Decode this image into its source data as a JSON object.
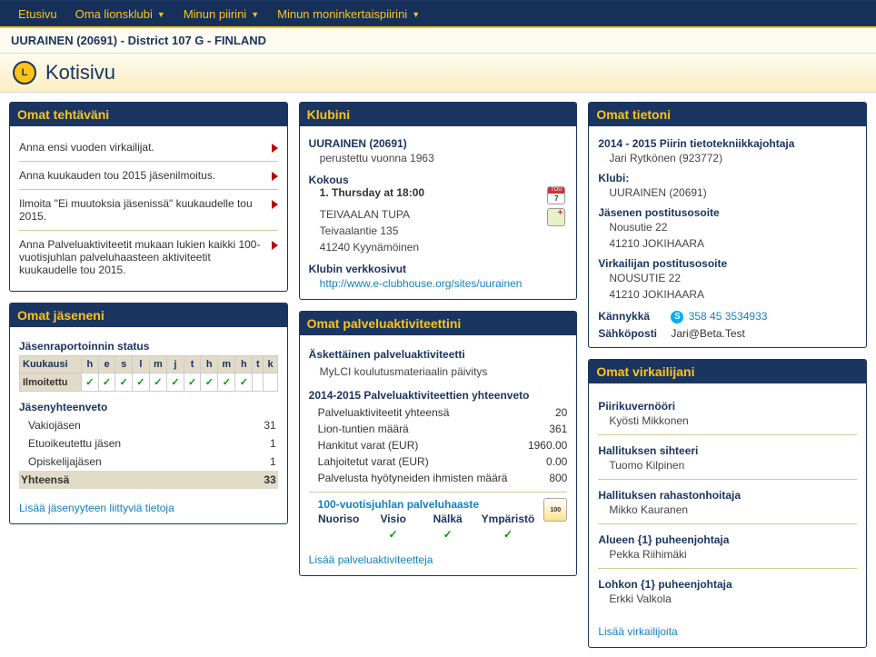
{
  "nav": {
    "home": "Etusivu",
    "club": "Oma lionsklubi",
    "district": "Minun piirini",
    "multi": "Minun moninkertaispiirini"
  },
  "breadcrumb": "UURAINEN (20691) - District 107 G - FINLAND",
  "page_title": "Kotisivu",
  "tasks": {
    "title": "Omat tehtäväni",
    "items": [
      "Anna ensi vuoden virkailijat.",
      "Anna kuukauden tou 2015 jäsenilmoitus.",
      "Ilmoita \"Ei muutoksia jäsenissä\" kuukaudelle tou 2015.",
      "Anna Palveluaktiviteetit mukaan lukien kaikki 100-vuotisjuhlan palveluhaasteen aktiviteetit kuukaudelle tou 2015."
    ]
  },
  "club": {
    "title": "Klubini",
    "name": "UURAINEN (20691)",
    "founded": "perustettu vuonna 1963",
    "meeting_label": "Kokous",
    "meeting_time": "1. Thursday at 18:00",
    "venue": "TEIVAALAN TUPA",
    "street": "Teivaalantie 135",
    "city": "41240 Kyynämöinen",
    "website_label": "Klubin verkkosivut",
    "website": "http://www.e-clubhouse.org/sites/uurainen",
    "cal_month": "TOU",
    "cal_day": "7"
  },
  "info": {
    "title": "Omat tietoni",
    "role": "2014 - 2015 Piirin tietotekniikkajohtaja",
    "name": "Jari Rytkönen (923772)",
    "club_label": "Klubi:",
    "club": "UURAINEN (20691)",
    "member_addr_label": "Jäsenen postitusosoite",
    "member_street": "Nousutie 22",
    "member_city": "41210 JOKIHAARA",
    "officer_addr_label": "Virkailijan postitusosoite",
    "officer_street": "NOUSUTIE 22",
    "officer_city": "41210 JOKIHAARA",
    "mobile_label": "Kännykkä",
    "mobile": "358 45 3534933",
    "email_label": "Sähköposti",
    "email": "Jari@Beta.Test"
  },
  "members": {
    "title": "Omat jäseneni",
    "report_title": "Jäsenraportoinnin status",
    "row_label": "Kuukausi",
    "reported_label": "Ilmoitettu",
    "months": [
      "h",
      "e",
      "s",
      "l",
      "m",
      "j",
      "t",
      "h",
      "m",
      "h",
      "t",
      "k"
    ],
    "checks": [
      true,
      true,
      true,
      true,
      true,
      true,
      true,
      true,
      true,
      true,
      false,
      false
    ],
    "summary_title": "Jäsenyhteenveto",
    "rows": [
      {
        "label": "Vakiojäsen",
        "value": "31"
      },
      {
        "label": "Etuoikeutettu jäsen",
        "value": "1"
      },
      {
        "label": "Opiskelijajäsen",
        "value": "1"
      }
    ],
    "total_label": "Yhteensä",
    "total_value": "33",
    "more": "Lisää jäsenyyteen liittyviä tietoja"
  },
  "activities": {
    "title": "Omat palveluaktiviteettini",
    "recent_title": "Äskettäinen palveluaktiviteetti",
    "recent_item": "MyLCI koulutusmateriaalin päivitys",
    "summary_title": "2014-2015 Palveluaktiviteettien yhteenveto",
    "rows": [
      {
        "label": "Palveluaktiviteetit yhteensä",
        "value": "20"
      },
      {
        "label": "Lion-tuntien määrä",
        "value": "361"
      },
      {
        "label": "Hankitut varat (EUR)",
        "value": "1960.00"
      },
      {
        "label": "Lahjoitetut varat (EUR)",
        "value": "0.00"
      },
      {
        "label": "Palvelusta hyötyneiden ihmisten määrä",
        "value": "800"
      }
    ],
    "cent_link": "100-vuotisjuhlan palveluhaaste",
    "cent_cats": [
      {
        "label": "Nuoriso",
        "done": false
      },
      {
        "label": "Visio",
        "done": true
      },
      {
        "label": "Nälkä",
        "done": true
      },
      {
        "label": "Ympäristö",
        "done": true
      }
    ],
    "more": "Lisää palveluaktiviteetteja"
  },
  "officers": {
    "title": "Omat virkailijani",
    "list": [
      {
        "role": "Piirikuvernööri",
        "name": "Kyösti Mikkonen"
      },
      {
        "role": "Hallituksen sihteeri",
        "name": "Tuomo Kilpinen"
      },
      {
        "role": "Hallituksen rahastonhoitaja",
        "name": "Mikko Kauranen"
      },
      {
        "role": "Alueen {1} puheenjohtaja",
        "name": "Pekka Riihimäki"
      },
      {
        "role": "Lohkon {1} puheenjohtaja",
        "name": "Erkki Valkola"
      }
    ],
    "more": "Lisää virkailijoita"
  }
}
